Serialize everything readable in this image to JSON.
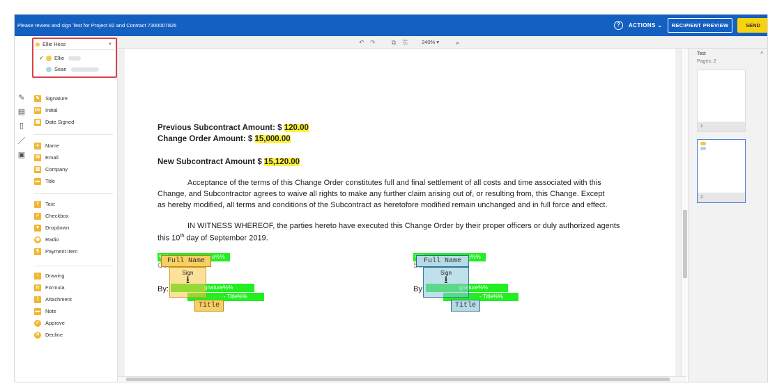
{
  "topbar": {
    "message": "Please review and sign Test for Project 82 and Contract 7300007826",
    "help_icon": "?",
    "actions_label": "ACTIONS ⌄",
    "recipient_preview_label": "RECIPIENT PREVIEW",
    "send_label": "SEND",
    "bg_color": "#1460c1",
    "send_color": "#f7d30f"
  },
  "recipients": {
    "selected": "Ellie Hess",
    "options": [
      {
        "name": "Ellie",
        "color": "#f7c948",
        "checked": true
      },
      {
        "name": "Sean",
        "color": "#a8d8ea",
        "checked": false
      }
    ]
  },
  "fields": {
    "signature": "Signature",
    "initial": "Initial",
    "date_signed": "Date Signed",
    "name": "Name",
    "email": "Email",
    "company": "Company",
    "title": "Title",
    "text": "Text",
    "checkbox": "Checkbox",
    "dropdown": "Dropdown",
    "radio": "Radio",
    "payment_item": "Payment Item",
    "drawing": "Drawing",
    "formula": "Formula",
    "attachment": "Attachment",
    "note": "Note",
    "approve": "Approve",
    "decline": "Decline",
    "initial_icon": "DS",
    "text_icon": "T",
    "formula_icon": "fx"
  },
  "toolbar": {
    "zoom": "240% ▾"
  },
  "document": {
    "prev_amount_label": "Previous Subcontract Amount: $ ",
    "prev_amount_value": "120.00",
    "change_amount_label": "Change Order Amount: $ ",
    "change_amount_value": "15,000.00",
    "new_amount_label": "New Subcontract Amount $ ",
    "new_amount_value": "15,120.00",
    "para1_line1": "Acceptance of the terms of this Change Order constitutes full and final settlement of all costs and time associated with this",
    "para1_line2": "Change, and Subcontractor agrees to waive all rights to make any further claim arising out of, or resulting from, this Change. Except",
    "para1_line3": "as hereby modified, all terms and conditions of the Subcontract as heretofore modified remain unchanged and in full force and effect.",
    "para2_line1": "IN WITNESS WHEREOF, the parties hereto have executed this Change Order by their proper officers or duly authorized agents",
    "para2_line2_pre": "this 10",
    "para2_line2_sup": "th",
    "para2_line2_post": " day of September 2019.",
    "left_party": "Contractor",
    "right_party": "Subcontractor",
    "by_label": "By:",
    "tag_name": "%%",
    "tag_name_suffix": "e%%",
    "tag_sig": "gnature%%",
    "tag_title": "- Title%%",
    "full_name_box": "Full Name",
    "sign_box_label": "Sign",
    "title_box": "Title"
  },
  "thumbnails": {
    "doc_name": "Test",
    "pages_label": "Pages: 2",
    "page1": "1",
    "page2": "2"
  }
}
